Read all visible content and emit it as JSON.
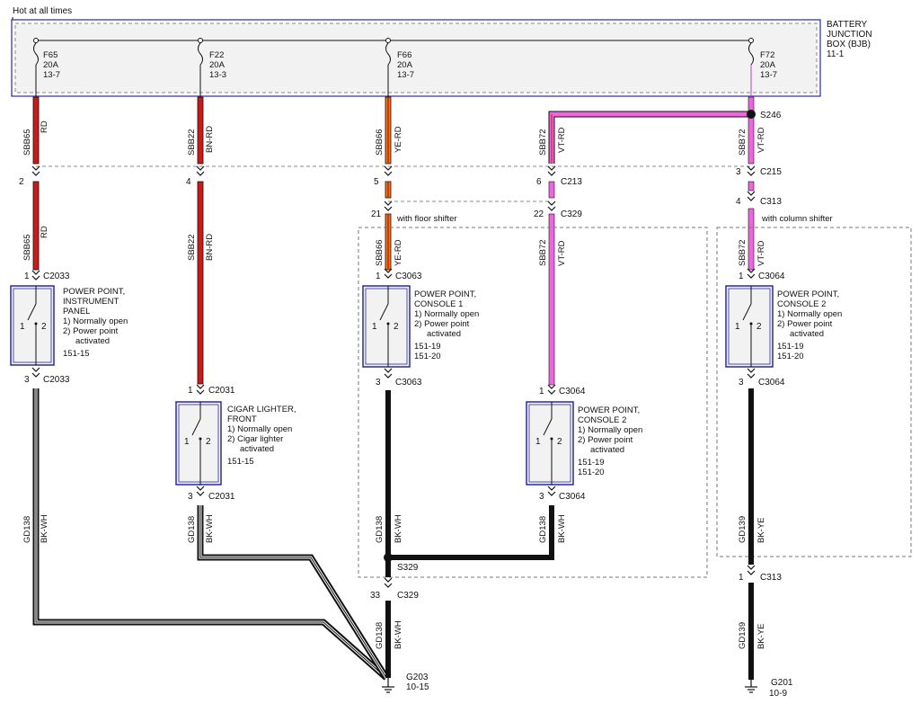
{
  "header": {
    "hot_label": "Hot at all times"
  },
  "bjb": {
    "line1": "BATTERY",
    "line2": "JUNCTION",
    "line3": "BOX (BJB)",
    "line4": "11-1"
  },
  "fuses": [
    {
      "name": "F65",
      "rating": "20A",
      "ref": "13-7"
    },
    {
      "name": "F22",
      "rating": "20A",
      "ref": "13-3"
    },
    {
      "name": "F66",
      "rating": "20A",
      "ref": "13-7"
    },
    {
      "name": "F72",
      "rating": "20A",
      "ref": "13-7"
    }
  ],
  "colors": {
    "red": "#cc1a1a",
    "orange": "#f07a10",
    "violet": "#ee66dd",
    "black": "#111111",
    "box_blue": "#2a2aa0",
    "dash": "#888888"
  },
  "circuits": {
    "c1": {
      "id": "SBB65",
      "color": "RD"
    },
    "c2": {
      "id": "SBB22",
      "color": "BN-RD"
    },
    "c3": {
      "id": "SBB66",
      "color": "YE-RD"
    },
    "c4": {
      "id": "SBB72",
      "color": "VT-RD"
    },
    "c5": {
      "id": "SBB72",
      "color": "VT-RD"
    },
    "g1": {
      "id": "GD138",
      "color": "BK-WH"
    },
    "g2": {
      "id": "GD139",
      "color": "BK-YE"
    }
  },
  "splices": {
    "s246": "S246",
    "s329": "S329"
  },
  "connectors": {
    "c213": "C213",
    "c215": "C215",
    "c313": "C313",
    "c329": "C329",
    "c2033": "C2033",
    "c2031": "C2031",
    "c3063": "C3063",
    "c3064": "C3064"
  },
  "pins": {
    "p2": "2",
    "p4": "4",
    "p5": "5",
    "p6": "6",
    "p3": "3",
    "p21": "21",
    "p22": "22",
    "p1": "1",
    "p33": "33"
  },
  "notes": {
    "floor": "with floor shifter",
    "column": "with column shifter"
  },
  "components": {
    "pp_ip": {
      "l1": "POWER POINT,",
      "l2": "INSTRUMENT",
      "l3": "PANEL",
      "l4": "1) Normally open",
      "l5": "2) Power point",
      "l6": "activated",
      "l7": "151-15"
    },
    "cigar": {
      "l1": "CIGAR LIGHTER,",
      "l2": "FRONT",
      "l3": "1) Normally open",
      "l4": "2) Cigar lighter",
      "l5": "activated",
      "l6": "151-15"
    },
    "pp_c1": {
      "l1": "POWER POINT,",
      "l2": "CONSOLE 1",
      "l3": "1) Normally open",
      "l4": "2) Power point",
      "l5": "activated",
      "l6": "151-19",
      "l7": "151-20"
    },
    "pp_c2a": {
      "l1": "POWER POINT,",
      "l2": "CONSOLE 2",
      "l3": "1) Normally open",
      "l4": "2) Power point",
      "l5": "activated",
      "l6": "151-19",
      "l7": "151-20"
    },
    "pp_c2b": {
      "l1": "POWER POINT,",
      "l2": "CONSOLE 2",
      "l3": "1) Normally open",
      "l4": "2) Power point",
      "l5": "activated",
      "l6": "151-19",
      "l7": "151-20"
    }
  },
  "switch_pins": {
    "a": "1",
    "b": "2"
  },
  "grounds": {
    "g203": {
      "name": "G203",
      "ref": "10-15"
    },
    "g201": {
      "name": "G201",
      "ref": "10-9"
    }
  }
}
